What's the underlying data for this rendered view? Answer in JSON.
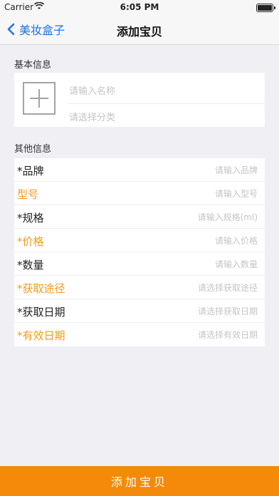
{
  "status_bar": {
    "carrier": "Carrier",
    "time": "6:05 PM"
  },
  "nav": {
    "back_label": "美妆盒子",
    "title": "添加宝贝"
  },
  "basic_section": {
    "header": "基本信息",
    "name_placeholder": "请输入名称",
    "category_placeholder": "请选择分类"
  },
  "other_section": {
    "header": "其他信息",
    "rows": [
      {
        "label": "*品牌",
        "placeholder": "请输入品牌",
        "highlight": false
      },
      {
        "label": "型号",
        "placeholder": "请输入型号",
        "highlight": true
      },
      {
        "label": "*规格",
        "placeholder": "请输入规格(ml)",
        "highlight": false
      },
      {
        "label": "*价格",
        "placeholder": "请输入价格",
        "highlight": true
      },
      {
        "label": "*数量",
        "placeholder": "请输入数量",
        "highlight": false
      },
      {
        "label": "*获取途径",
        "placeholder": "请选择获取途径",
        "highlight": true
      },
      {
        "label": "*获取日期",
        "placeholder": "请选择获取日期",
        "highlight": false
      },
      {
        "label": "*有效日期",
        "placeholder": "请选择有效日期",
        "highlight": true
      }
    ]
  },
  "submit": {
    "label": "添加宝贝"
  },
  "colors": {
    "accent": "#f58a0a",
    "highlight_label": "#f59a1b",
    "link": "#1a73e8"
  },
  "icons": [
    "back-chevron-icon",
    "wifi-icon",
    "battery-icon",
    "add-photo-icon"
  ]
}
